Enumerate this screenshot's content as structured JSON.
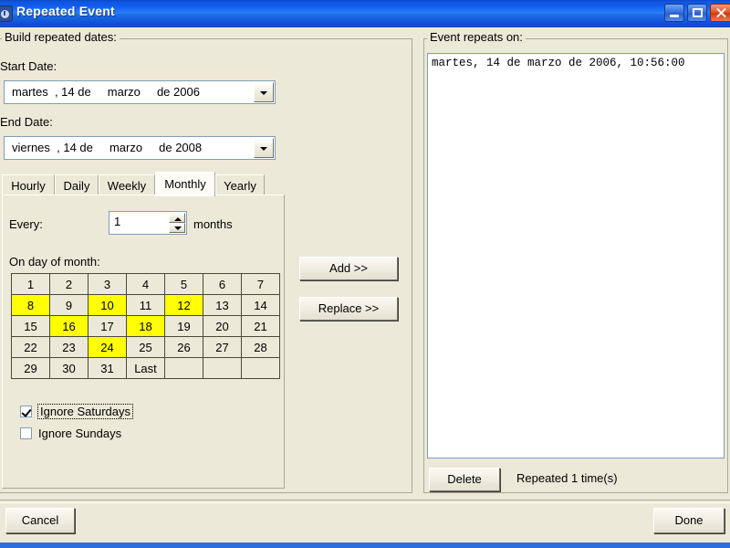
{
  "window": {
    "title": "Repeated Event",
    "icon": "app-icon",
    "buttons": {
      "minimize": "minimize-icon",
      "maximize": "maximize-icon",
      "close": "close-icon"
    }
  },
  "left_group": {
    "legend": "Build repeated dates:",
    "start_date": {
      "label": "Start Date:",
      "value": "martes  , 14 de     marzo     de 2006"
    },
    "end_date": {
      "label": "End Date:",
      "value": "viernes  , 14 de     marzo     de 2008"
    },
    "tabs": [
      {
        "label": "Hourly",
        "selected": false
      },
      {
        "label": "Daily",
        "selected": false
      },
      {
        "label": "Weekly",
        "selected": false
      },
      {
        "label": "Monthly",
        "selected": true
      },
      {
        "label": "Yearly",
        "selected": false
      }
    ],
    "monthly_panel": {
      "every_label": "Every:",
      "every_value": "1",
      "units_label": "months",
      "on_day_label": "On day of month:",
      "day_grid": [
        [
          "1",
          "2",
          "3",
          "4",
          "5",
          "6",
          "7"
        ],
        [
          "8",
          "9",
          "10",
          "11",
          "12",
          "13",
          "14"
        ],
        [
          "15",
          "16",
          "17",
          "18",
          "19",
          "20",
          "21"
        ],
        [
          "22",
          "23",
          "24",
          "25",
          "26",
          "27",
          "28"
        ],
        [
          "29",
          "30",
          "31",
          "Last",
          "",
          "",
          ""
        ]
      ],
      "selected_days": [
        "8",
        "10",
        "12",
        "16",
        "18",
        "24"
      ],
      "highlight_color": "#ffff00",
      "ignore_saturdays": {
        "label": "Ignore Saturdays",
        "checked": true,
        "focused": true
      },
      "ignore_sundays": {
        "label": "Ignore Sundays",
        "checked": false,
        "focused": false
      }
    }
  },
  "middle_buttons": {
    "add": "Add >>",
    "replace": "Replace >>"
  },
  "right_group": {
    "legend": "Event repeats on:",
    "items": [
      "martes, 14 de marzo de 2006, 10:56:00"
    ],
    "delete_button": "Delete",
    "status": "Repeated 1 time(s)"
  },
  "footer": {
    "cancel": "Cancel",
    "done": "Done"
  }
}
